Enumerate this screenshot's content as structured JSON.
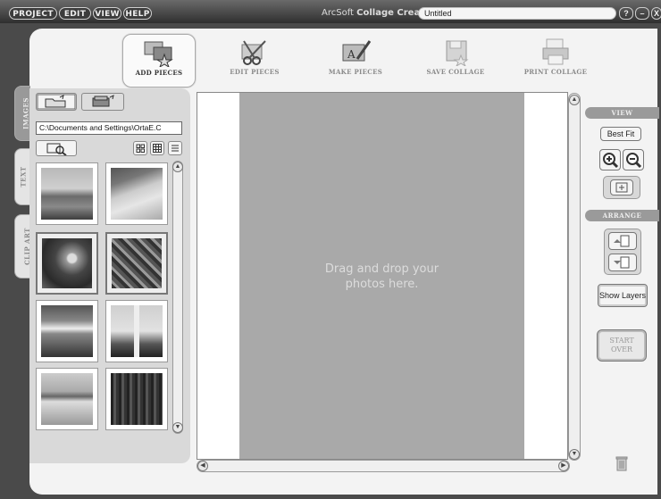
{
  "menu": [
    "PROJECT",
    "EDIT",
    "VIEW",
    "HELP"
  ],
  "app": {
    "title_prefix": "ArcSoft",
    "title_name": "Collage Creator",
    "document_name": "Untitled"
  },
  "window_controls": [
    "?",
    "–",
    "X"
  ],
  "toolbar": [
    {
      "label": "ADD PIECES",
      "icon": "add-pieces-icon",
      "active": true
    },
    {
      "label": "EDIT PIECES",
      "icon": "scissors-icon",
      "active": false
    },
    {
      "label": "MAKE PIECES",
      "icon": "make-pieces-icon",
      "active": false
    },
    {
      "label": "SAVE COLLAGE",
      "icon": "floppy-disk-icon",
      "active": false
    },
    {
      "label": "PRINT COLLAGE",
      "icon": "printer-icon",
      "active": false
    }
  ],
  "side_tabs": [
    "IMAGES",
    "TEXT",
    "CLIP ART"
  ],
  "images_panel": {
    "path": "C:\\Documents and Settings\\OrtaE.C",
    "thumbnails": [
      {
        "name": "thumb-landscape",
        "selected": false
      },
      {
        "name": "thumb-beach",
        "selected": false
      },
      {
        "name": "thumb-child",
        "selected": true
      },
      {
        "name": "thumb-flowers",
        "selected": true
      },
      {
        "name": "thumb-sunset",
        "selected": false
      },
      {
        "name": "thumb-lighthouse",
        "selected": false
      },
      {
        "name": "thumb-lake",
        "selected": false
      },
      {
        "name": "thumb-forest",
        "selected": false
      }
    ]
  },
  "canvas": {
    "drop_text": "Drag and drop your\nphotos here."
  },
  "right_panel": {
    "view_header": "VIEW",
    "best_fit": "Best Fit",
    "arrange_header": "ARRANGE",
    "show_layers": "Show Layers",
    "start_over": "START\nOVER"
  }
}
